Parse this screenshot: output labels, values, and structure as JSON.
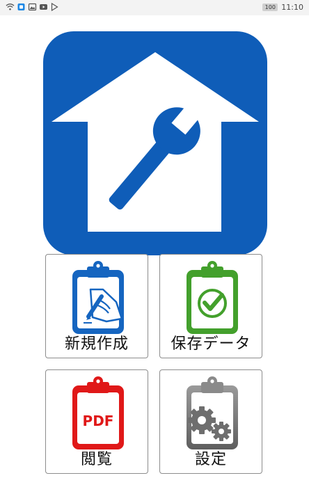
{
  "status_bar": {
    "battery": "100",
    "time": "11:10"
  },
  "app": {
    "logo_icon": "house-wrench-icon",
    "accent": "#0f5db8"
  },
  "tiles": [
    {
      "label": "新規作成",
      "icon": "clipboard-pen-icon",
      "color": "#1565c0"
    },
    {
      "label": "保存データ",
      "icon": "clipboard-check-icon",
      "color": "#43a02c"
    },
    {
      "label": "閲覧",
      "icon": "clipboard-pdf-icon",
      "color": "#e01818",
      "badge": "PDF"
    },
    {
      "label": "設定",
      "icon": "clipboard-gears-icon",
      "color": "#8a8a8a"
    }
  ]
}
